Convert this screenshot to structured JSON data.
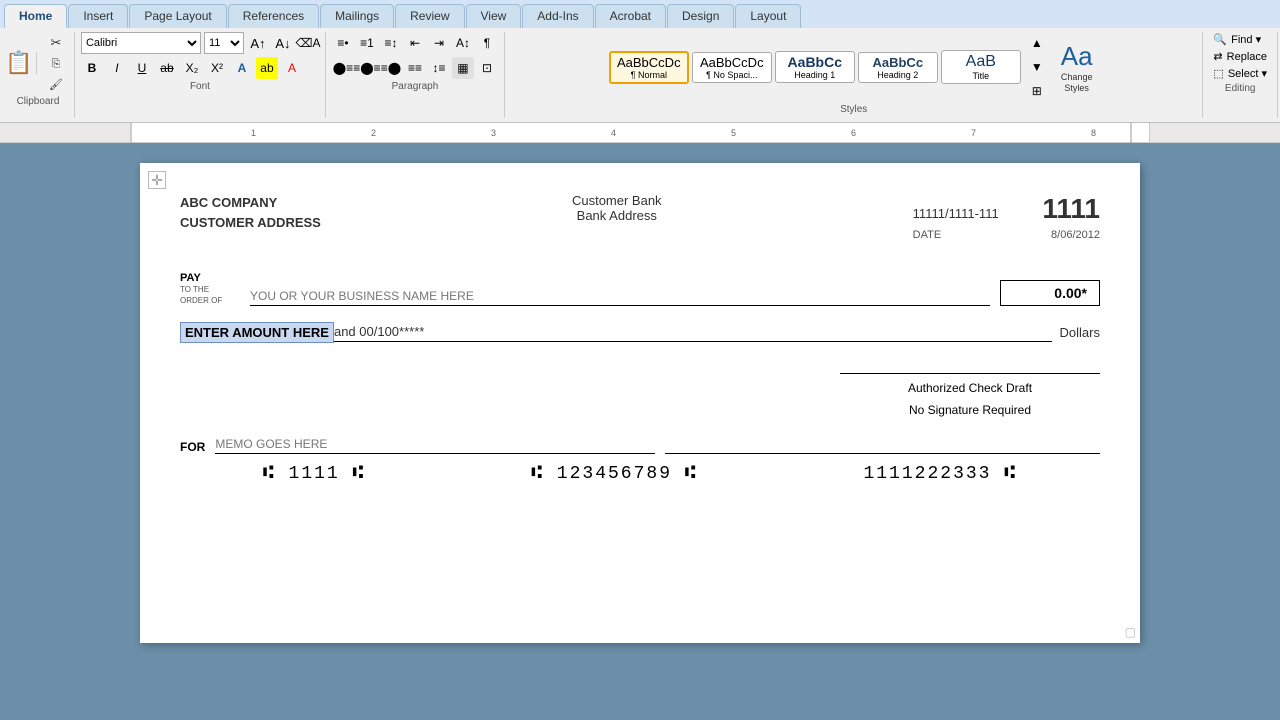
{
  "tabs": [
    {
      "label": "Home",
      "active": true
    },
    {
      "label": "Insert",
      "active": false
    },
    {
      "label": "Page Layout",
      "active": false
    },
    {
      "label": "References",
      "active": false
    },
    {
      "label": "Mailings",
      "active": false
    },
    {
      "label": "Review",
      "active": false
    },
    {
      "label": "View",
      "active": false
    },
    {
      "label": "Add-Ins",
      "active": false
    },
    {
      "label": "Acrobat",
      "active": false
    },
    {
      "label": "Design",
      "active": false
    },
    {
      "label": "Layout",
      "active": false
    }
  ],
  "ribbon": {
    "font": {
      "name": "Calibri",
      "size": "11"
    },
    "styles": [
      {
        "label": "AaBbCcDc",
        "sub": "¶ Normal",
        "active": true
      },
      {
        "label": "AaBbCcDc",
        "sub": "¶ No Spaci...",
        "active": false
      },
      {
        "label": "AaBbCc",
        "sub": "Heading 1",
        "active": false
      },
      {
        "label": "AaBbCc",
        "sub": "Heading 2",
        "active": false
      },
      {
        "label": "AaB",
        "sub": "Title",
        "active": false
      }
    ],
    "change_styles_label": "Change\nStyles",
    "find_label": "Find ▾",
    "replace_label": "Replace",
    "select_label": "Select ▾",
    "editing_label": "Editing"
  },
  "check": {
    "company_name": "ABC COMPANY",
    "company_address": "CUSTOMER ADDRESS",
    "bank_name": "Customer Bank",
    "bank_address": "Bank Address",
    "routing": "11111/1111-111",
    "date_label": "DATE",
    "date_value": "8/06/2012",
    "check_number": "1111",
    "pay_label": "PAY",
    "pay_to_label": "TO THE",
    "order_of_label": "ORDER OF",
    "payee_placeholder": "YOU OR YOUR BUSINESS NAME HERE",
    "amount_placeholder": "0.00*",
    "amount_text_highlighted": "ENTER AMOUNT HERE",
    "amount_text_rest": " and 00/100*****",
    "dollars_label": "Dollars",
    "authorized_line1": "Authorized Check Draft",
    "authorized_line2": "No Signature Required",
    "for_label": "FOR",
    "memo_placeholder": "MEMO GOES HERE",
    "micr_left": "⑆ 1111 ⑆",
    "micr_mid": "⑆ 123456789 ⑆",
    "micr_right": "1111222333 ⑆"
  }
}
